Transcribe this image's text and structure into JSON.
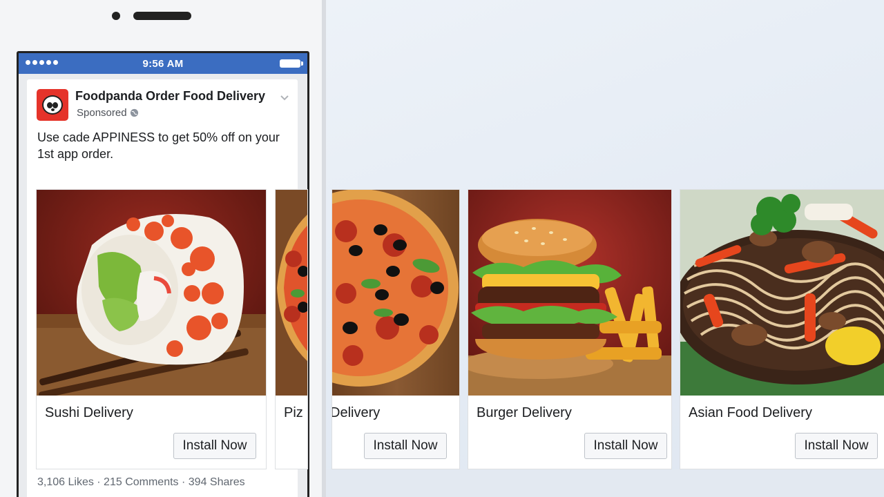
{
  "status_bar": {
    "time": "9:56 AM"
  },
  "post": {
    "page_name": "Foodpanda Order Food Delivery",
    "sponsored": "Sponsored",
    "text": "Use cade APPINESS to get 50% off on your 1st app order.",
    "brand_color": "#e5332a"
  },
  "carousel": [
    {
      "title": "Sushi Delivery",
      "button": "Install Now",
      "image": "sushi-roll"
    },
    {
      "title": "Pizza Delivery",
      "title_visible_left": "Piz",
      "title_visible_right": "Delivery",
      "button": "Install Now",
      "image": "pepperoni-pizza"
    },
    {
      "title": "Burger Delivery",
      "button": "Install Now",
      "image": "burger-with-fries"
    },
    {
      "title": "Asian Food Delivery",
      "button": "Install Now",
      "image": "noodle-stir-fry"
    }
  ],
  "engagement": "3,106 Likes · 215 Comments · 394 Shares",
  "colors": {
    "status_bar": "#3b6dc1",
    "card_border": "#dddfe2",
    "button_bg": "#f6f7f9"
  }
}
